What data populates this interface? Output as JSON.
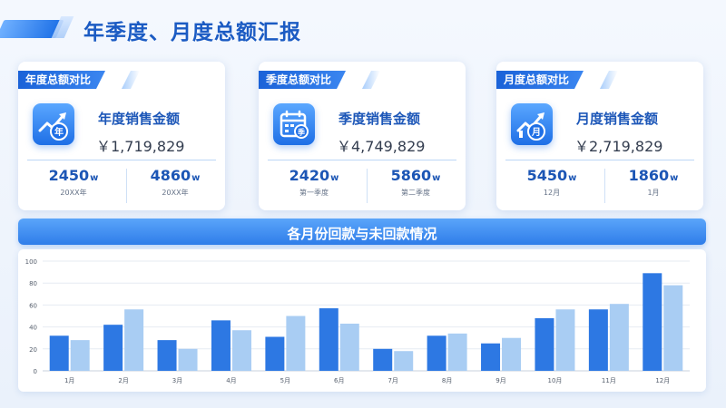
{
  "page": {
    "title": "年季度、月度总额汇报"
  },
  "cards": [
    {
      "tag": "年度总额对比",
      "icon": "year-sales-icon",
      "icon_char": "年",
      "label": "年度销售金额",
      "amount": "￥1,719,829",
      "stats": [
        {
          "value": "2450",
          "unit": "w",
          "label": "20XX年"
        },
        {
          "value": "4860",
          "unit": "w",
          "label": "20XX年"
        }
      ]
    },
    {
      "tag": "季度总额对比",
      "icon": "calendar-icon",
      "icon_char": "季",
      "label": "季度销售金额",
      "amount": "￥4,749,829",
      "stats": [
        {
          "value": "2420",
          "unit": "w",
          "label": "第一季度"
        },
        {
          "value": "5860",
          "unit": "w",
          "label": "第二季度"
        }
      ]
    },
    {
      "tag": "月度总额对比",
      "icon": "month-sales-icon",
      "icon_char": "月",
      "label": "月度销售金额",
      "amount": "￥2,719,829",
      "stats": [
        {
          "value": "5450",
          "unit": "w",
          "label": "12月"
        },
        {
          "value": "1860",
          "unit": "w",
          "label": "1月"
        }
      ]
    }
  ],
  "section": {
    "title": "各月份回款与未回款情况"
  },
  "colors": {
    "primary": "#2f7de9",
    "series_dark": "#2d78e3",
    "series_light": "#a9cdf3",
    "title": "#1b5bc3"
  },
  "chart_data": {
    "type": "bar",
    "categories": [
      "1月",
      "2月",
      "3月",
      "4月",
      "5月",
      "6月",
      "7月",
      "8月",
      "9月",
      "10月",
      "11月",
      "12月"
    ],
    "series": [
      {
        "values": [
          32,
          42,
          28,
          46,
          31,
          57,
          20,
          32,
          25,
          48,
          56,
          89
        ]
      },
      {
        "values": [
          28,
          56,
          20,
          37,
          50,
          43,
          18,
          34,
          30,
          56,
          61,
          78
        ]
      }
    ],
    "y_ticks": [
      "0",
      "20",
      "40",
      "60",
      "80",
      "100"
    ],
    "ylim": [
      0,
      100
    ],
    "grid": true,
    "legend": "none"
  }
}
